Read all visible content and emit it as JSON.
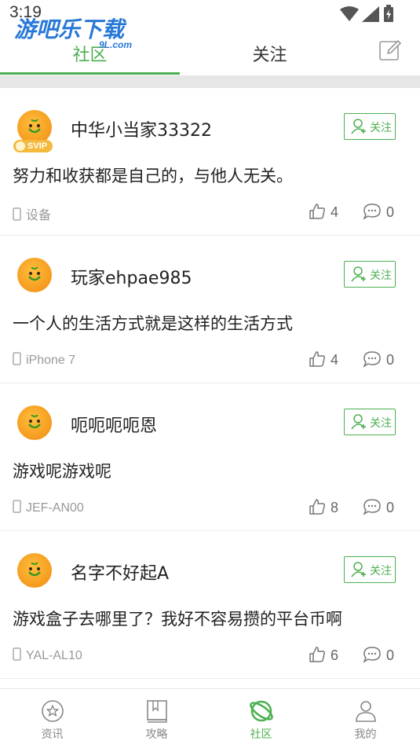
{
  "status_bar": {
    "time": "3:19"
  },
  "watermark": {
    "text": "游吧乐下载",
    "sub": "9L.com"
  },
  "top_tabs": [
    {
      "label": "社区",
      "active": true
    },
    {
      "label": "关注",
      "active": false
    }
  ],
  "colors": {
    "accent": "#4caf50",
    "muted": "#999999",
    "band": "#e6e6e6"
  },
  "posts": [
    {
      "username": "中华小当家33322",
      "vip": "SVIP",
      "follow_label": "关注",
      "text": "努力和收获都是自己的，与他人无关。",
      "device": "设备",
      "likes": "4",
      "comments": "0"
    },
    {
      "username": "玩家ehpae985",
      "follow_label": "关注",
      "text": "一个人的生活方式就是这样的生活方式",
      "device": "iPhone 7",
      "likes": "4",
      "comments": "0"
    },
    {
      "username": "呃呃呃呃恩",
      "follow_label": "关注",
      "text": "游戏呢游戏呢",
      "device": "JEF-AN00",
      "likes": "8",
      "comments": "0"
    },
    {
      "username": "名字不好起A",
      "follow_label": "关注",
      "text": "游戏盒子去哪里了？我好不容易攒的平台币啊",
      "device": "YAL-AL10",
      "likes": "6",
      "comments": "0"
    }
  ],
  "bottom_nav": [
    {
      "label": "资讯",
      "icon": "star-circle-icon",
      "active": false
    },
    {
      "label": "攻略",
      "icon": "book-icon",
      "active": false
    },
    {
      "label": "社区",
      "icon": "planet-icon",
      "active": true
    },
    {
      "label": "我的",
      "icon": "user-icon",
      "active": false
    }
  ]
}
